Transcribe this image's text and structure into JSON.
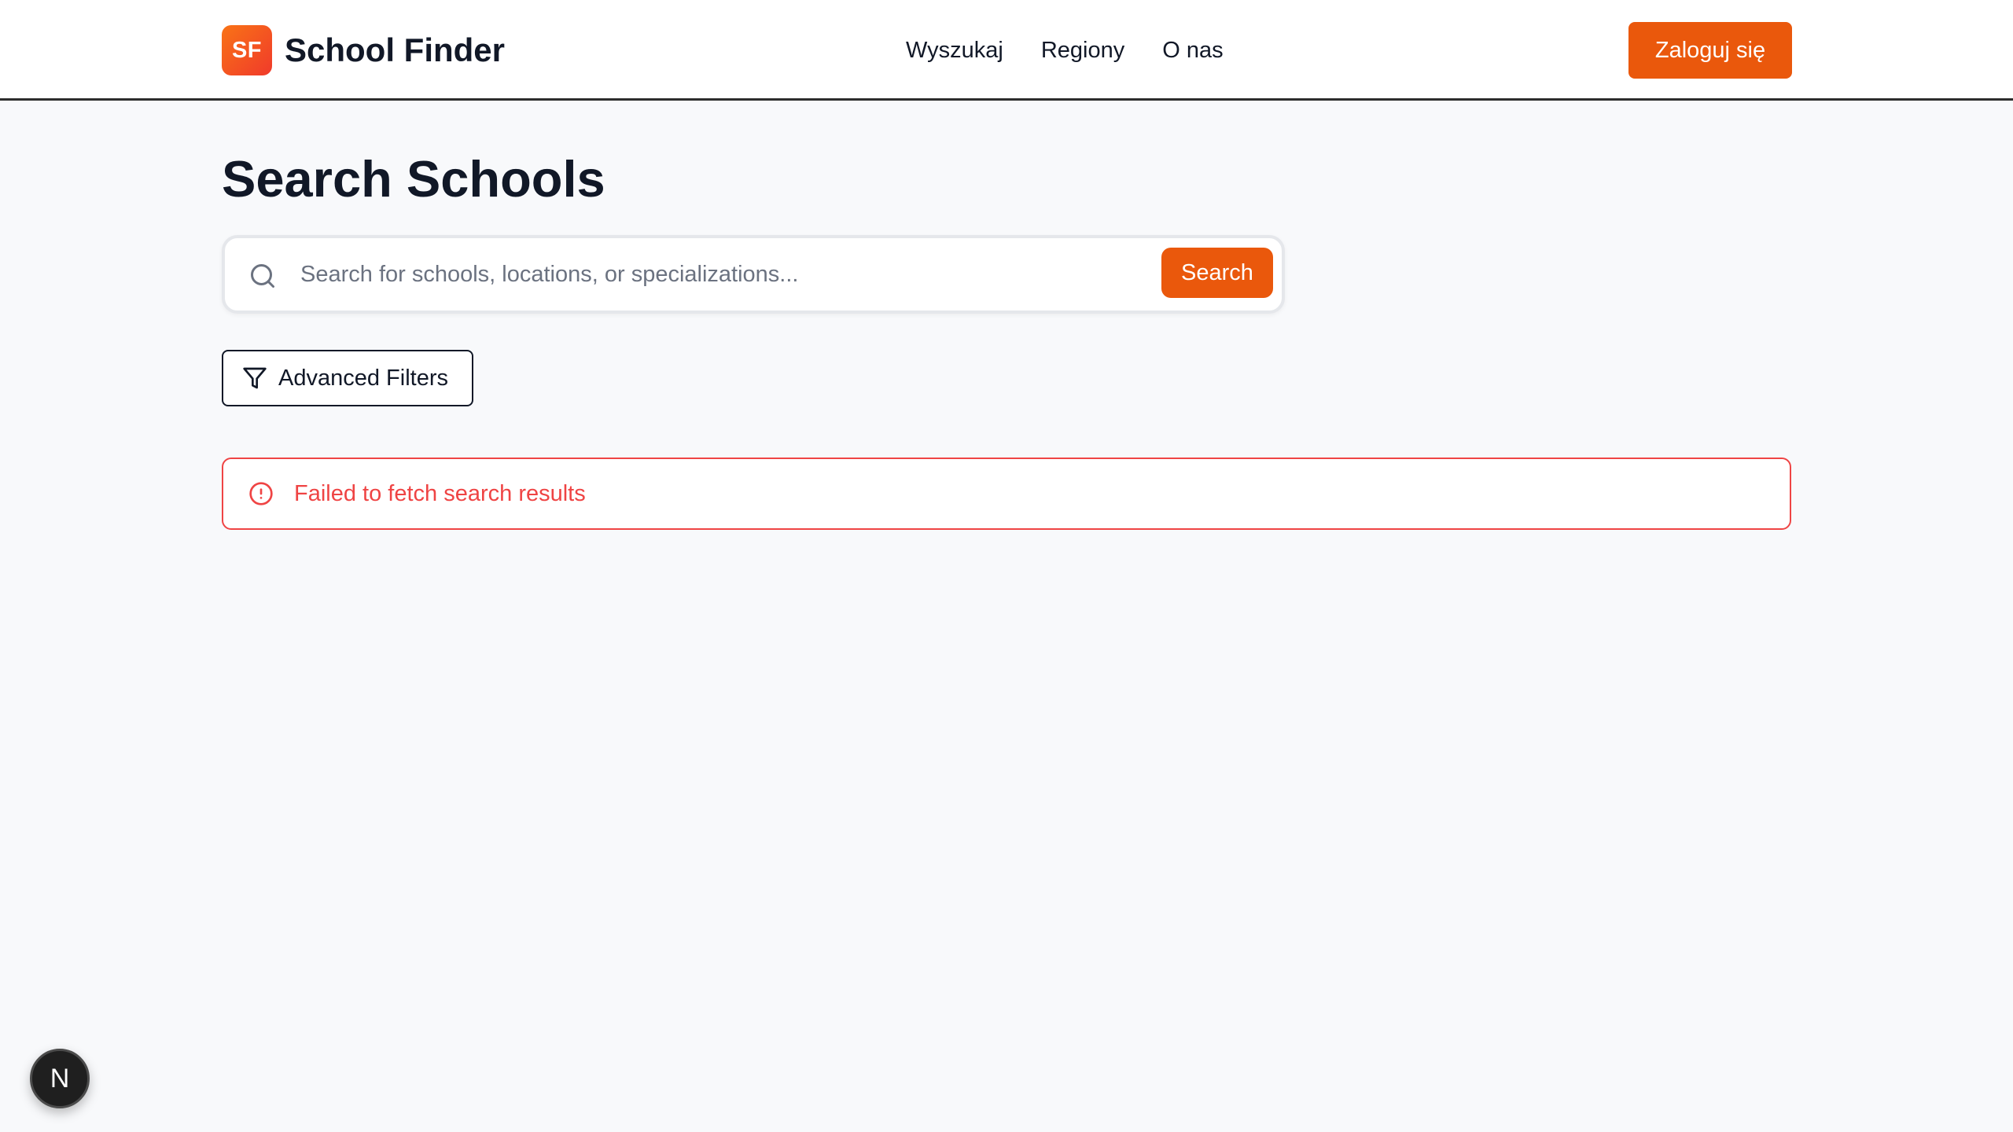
{
  "header": {
    "logo_initials": "SF",
    "app_name": "School Finder",
    "nav": [
      {
        "label": "Wyszukaj"
      },
      {
        "label": "Regiony"
      },
      {
        "label": "O nas"
      }
    ],
    "login_label": "Zaloguj się"
  },
  "main": {
    "title": "Search Schools",
    "search": {
      "placeholder": "Search for schools, locations, or specializations...",
      "value": "",
      "button_label": "Search"
    },
    "filters_label": "Advanced Filters",
    "error_message": "Failed to fetch search results"
  },
  "dev_badge_label": "N",
  "colors": {
    "accent": "#ea580c",
    "error": "#ef4444",
    "background": "#f8f9fb",
    "text": "#111827"
  },
  "icons": {
    "search": "search-icon",
    "filter": "filter-icon",
    "alert": "alert-circle-icon"
  }
}
